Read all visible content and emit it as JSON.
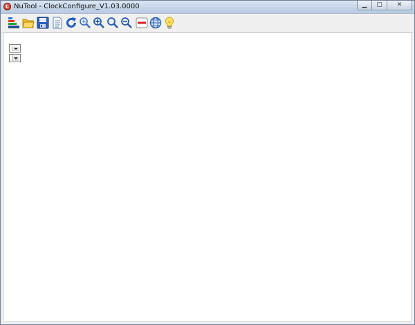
{
  "window": {
    "title": "NuTool - ClockConfigure_V1.03.0000",
    "controls": {
      "minimize": "▁",
      "maximize": "▢",
      "close": "✕"
    }
  },
  "toolbar": {
    "buttons": [
      {
        "name": "chip-stack-icon"
      },
      {
        "name": "open-folder-icon"
      },
      {
        "name": "save-icon"
      },
      {
        "name": "document-icon"
      },
      {
        "name": "refresh-icon"
      },
      {
        "name": "zoom-reset-icon"
      },
      {
        "name": "zoom-in-icon"
      },
      {
        "name": "zoom-fit-icon"
      },
      {
        "name": "zoom-out-icon"
      },
      {
        "name": "minus-icon"
      },
      {
        "name": "globe-icon"
      },
      {
        "name": "lightbulb-icon"
      }
    ]
  },
  "client": {
    "dropdowns": [
      {
        "selected": ""
      },
      {
        "selected": ""
      }
    ]
  }
}
